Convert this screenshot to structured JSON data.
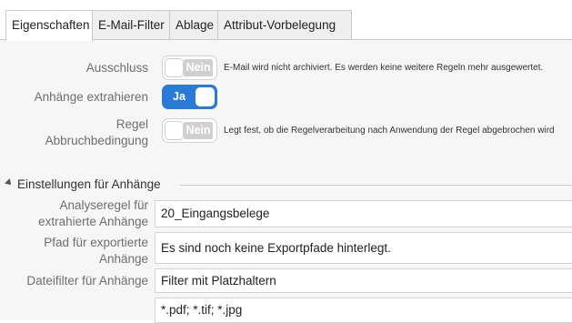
{
  "tabs": [
    {
      "label": "Eigenschaften",
      "active": true
    },
    {
      "label": "E-Mail-Filter",
      "active": false
    },
    {
      "label": "Ablage",
      "active": false
    },
    {
      "label": "Attribut-Vorbelegung",
      "active": false
    }
  ],
  "settings": {
    "ausschluss": {
      "label": "Ausschluss",
      "state": "Nein",
      "hint": "E-Mail wird nicht archiviert. Es werden keine weitere Regeln mehr ausgewertet."
    },
    "anhaenge": {
      "label": "Anhänge extrahieren",
      "state": "Ja"
    },
    "abbruch": {
      "label_line1": "Regel",
      "label_line2": "Abbruchbedingung",
      "state": "Nein",
      "hint": "Legt fest, ob die Regelverarbeitung nach Anwendung der Regel abgebrochen wird"
    }
  },
  "section": {
    "title": "Einstellungen für Anhänge",
    "analyseregel": {
      "label_line1": "Analyseregel für",
      "label_line2": "extrahierte Anhänge",
      "value": "20_Eingangsbelege"
    },
    "pfad": {
      "label_line1": "Pfad für exportierte",
      "label_line2": "Anhänge",
      "value": "Es sind noch keine Exportpfade hinterlegt."
    },
    "dateifilter": {
      "label": "Dateifilter für Anhänge",
      "value": "Filter mit Platzhaltern"
    },
    "filter_pattern": {
      "value": "*.pdf; *.tif; *.jpg"
    }
  },
  "colors": {
    "toggle_on": "#2a7bd6",
    "toggle_off_badge": "#d0d0d0",
    "content_bg": "#f6f6f6"
  }
}
